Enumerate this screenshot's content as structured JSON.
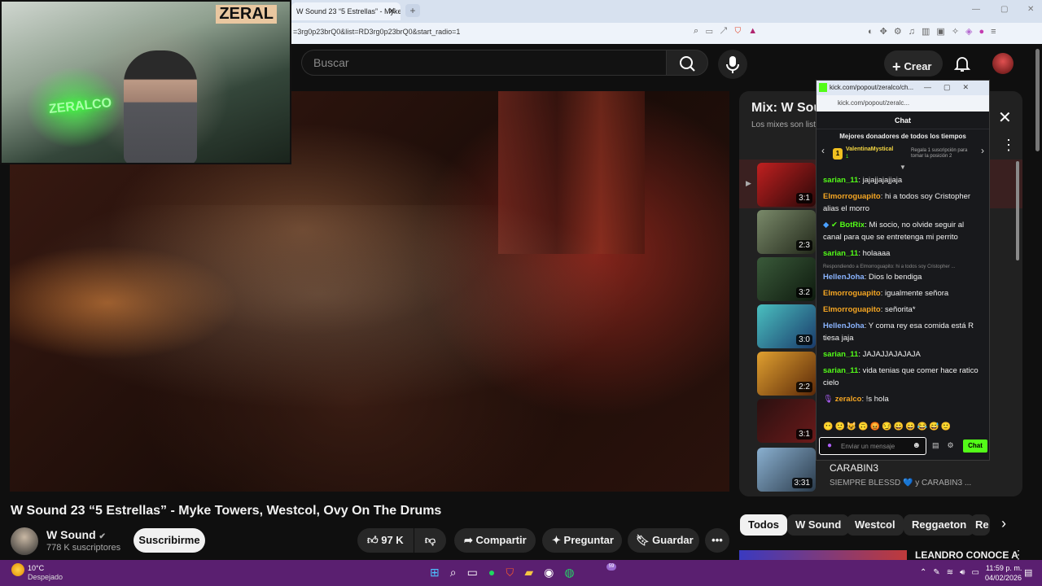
{
  "browser": {
    "tab_title": "W Sound 23 “5 Estrellas” - Myke",
    "url": "=3rg0p23brQ0&list=RD3rg0p23brQ0&start_radio=1"
  },
  "yt_header": {
    "search_placeholder": "Buscar",
    "create_label": "Crear"
  },
  "webcam": {
    "overlay_text": "ZERAL",
    "neon_text": "ZERALCO"
  },
  "mix_panel": {
    "title": "Mix: W Sou",
    "subtitle": "Los mixes son list",
    "items": [
      {
        "duration": "3:1"
      },
      {
        "duration": "2:3"
      },
      {
        "duration": "3:2"
      },
      {
        "duration": "3:0"
      },
      {
        "duration": "2:2"
      },
      {
        "duration": "3:1"
      },
      {
        "duration": "3:31",
        "title": "CARABIN3",
        "subtitle": "SIEMPRE BLESSD 💙 y CARABIN3 ..."
      }
    ]
  },
  "chat": {
    "window_title": "kick.com/popout/zeralco/ch...",
    "url": "kick.com/popout/zeralc...",
    "header": "Chat",
    "donors_title": "Mejores donadores de todos los tiempos",
    "top_donor": {
      "rank": "1",
      "name": "ValentinaMystical",
      "amount": "1",
      "gift_text": "Regala 1 suscripción para tomar la posición 2"
    },
    "messages": [
      {
        "user": "sarian_11",
        "color": "#53fc18",
        "text": "jajajjajajjaja"
      },
      {
        "user": "Elmorroguapito",
        "color": "#f5a623",
        "text": "hi a todos soy Cristopher alias el morro"
      },
      {
        "user": "BotRix",
        "color": "#53fc18",
        "text": "Mi socio, no olvide seguir al canal para que se entretenga mi perrito"
      },
      {
        "user": "sarian_11",
        "color": "#53fc18",
        "text": "holaaaa"
      },
      {
        "reply_note": "Respondiendo a Elmorroguapito: hi a todos soy Cristopher ..."
      },
      {
        "user": "HellenJoha",
        "color": "#8ab4ff",
        "text": "Dios lo bendiga"
      },
      {
        "user": "Elmorroguapito",
        "color": "#f5a623",
        "text": "igualmente señora"
      },
      {
        "user": "Elmorroguapito",
        "color": "#f5a623",
        "text": "señorita*"
      },
      {
        "user": "HellenJoha",
        "color": "#8ab4ff",
        "text": "Y coma rey esa comida está R tiesa jaja"
      },
      {
        "user": "sarian_11",
        "color": "#53fc18",
        "text": "JAJAJJAJAJAJA"
      },
      {
        "user": "sarian_11",
        "color": "#53fc18",
        "text": "vida tenias que comer hace ratico cielo"
      },
      {
        "user": "zeralco",
        "color": "#f5a623",
        "text": "!s hola"
      }
    ],
    "input_placeholder": "Enviar un mensaje",
    "send_label": "Chat"
  },
  "video": {
    "title": "W Sound 23 “5 Estrellas” - Myke Towers, Westcol, Ovy On The Drums",
    "channel": "W Sound",
    "subscribers": "778 K suscriptores",
    "subscribe_label": "Suscribirme",
    "likes": "97 K",
    "share_label": "Compartir",
    "ask_label": "Preguntar",
    "save_label": "Guardar"
  },
  "chips": [
    "Todos",
    "W Sound",
    "Westcol",
    "Reggaeton",
    "Re"
  ],
  "next_row_title": "LEANDRO CONOCE A",
  "taskbar": {
    "temp": "10°C",
    "weather": "Despejado",
    "time": "11:59 p. m.",
    "date": "04/02/2026",
    "badge": "59"
  }
}
